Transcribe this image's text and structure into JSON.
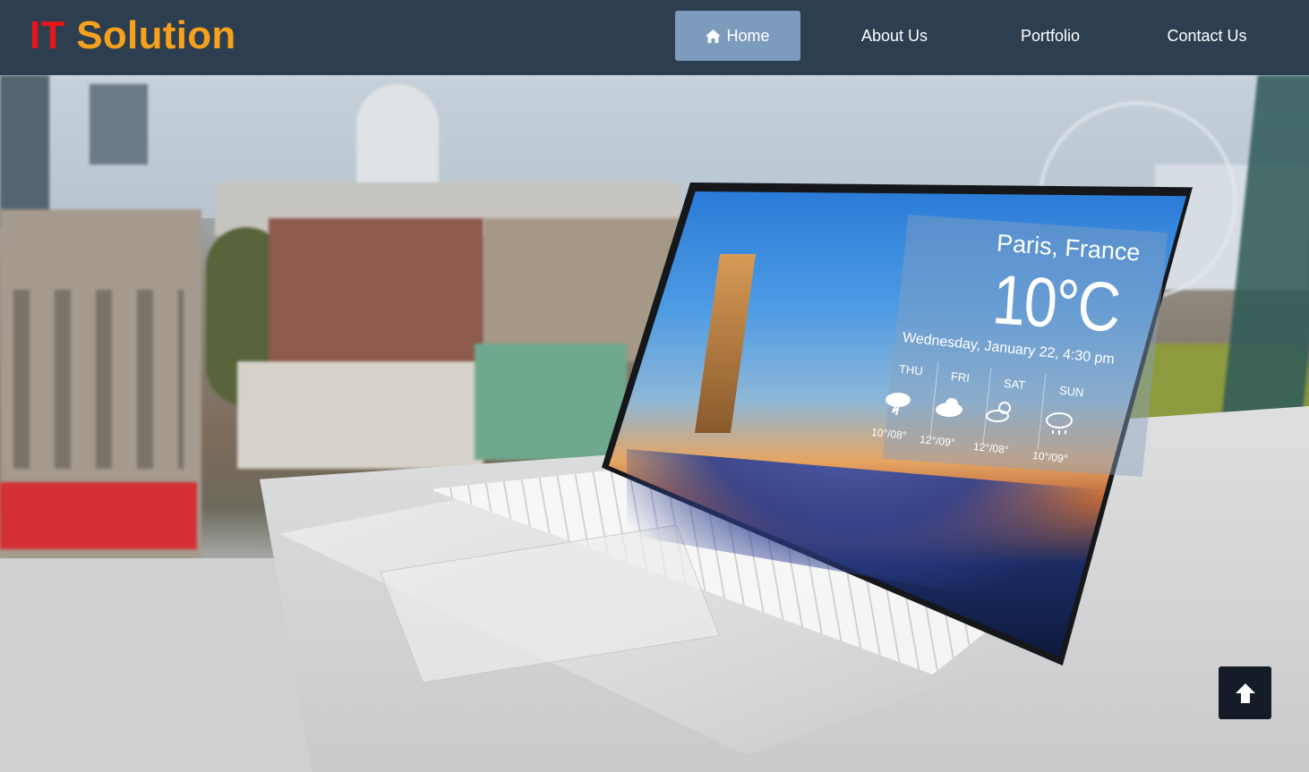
{
  "brand": {
    "part1": "IT",
    "part2": "Solution",
    "color1": "#e8141b",
    "color2": "#f5a11c"
  },
  "nav": {
    "background": "#2c3e50",
    "active_color": "#7d9bbd",
    "items": [
      {
        "label": "Home",
        "icon": "home-icon",
        "active": true
      },
      {
        "label": "About Us",
        "active": false
      },
      {
        "label": "Portfolio",
        "active": false
      },
      {
        "label": "Contact Us",
        "active": false
      }
    ]
  },
  "hero": {
    "weather": {
      "city": "Paris, France",
      "temperature": "10°C",
      "datetime": "Wednesday, January 22, 4:30 pm",
      "forecast": [
        {
          "day": "THU",
          "range": "10°/08°",
          "icon": "thunderstorm-icon"
        },
        {
          "day": "FRI",
          "range": "12°/09°",
          "icon": "cloud-icon"
        },
        {
          "day": "SAT",
          "range": "12°/08°",
          "icon": "partly-sunny-icon"
        },
        {
          "day": "SUN",
          "range": "10°/09°",
          "icon": "rain-icon"
        }
      ]
    }
  },
  "scroll_top": {
    "icon": "arrow-up-icon"
  }
}
